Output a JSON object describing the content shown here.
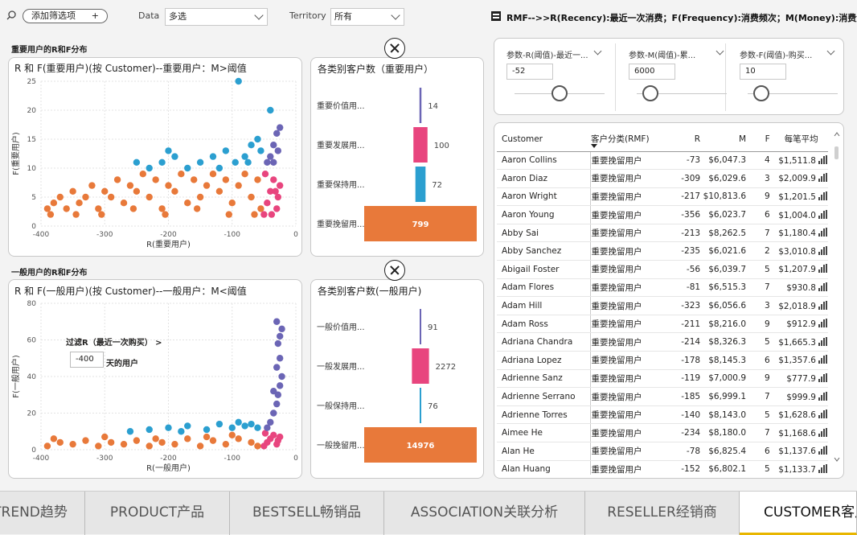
{
  "toolbar": {
    "add_filter": "添加筛选项",
    "add_filter_plus": "+",
    "data_label": "Data",
    "data_value": "多选",
    "territory_label": "Territory",
    "territory_value": "所有",
    "rmf_note": "RMF-->>R(Recency):最近一次消费；F(Frequency):消费频次；M(Money):消费金额"
  },
  "important": {
    "section_title": "重要用户的R和F分布",
    "scatter_title": "R 和 F(重要用户)(按 Customer)--重要用户：M>阈值",
    "bar_title": "各类别客户数（重要用户）"
  },
  "general": {
    "section_title": "一般用户的R和F分布",
    "scatter_title": "R 和 F(一般用户)(按 Customer)--一般用户：M<阈值",
    "bar_title": "各类别客户数(一般用户)",
    "filter_label": "过滤R（最近一次购买） >",
    "filter_value": "-400",
    "filter_suffix": "天的用户"
  },
  "params": [
    {
      "title": "参数-R(阈值)-最近一...",
      "value": "-52",
      "level": 0.5
    },
    {
      "title": "参数-M(阈值)-累...",
      "value": "6000",
      "level": 0.15
    },
    {
      "title": "参数-F(阈值)-购买...",
      "value": "10",
      "level": 0.15
    }
  ],
  "table": {
    "columns": [
      "Customer",
      "客户分类(RMF)",
      "R",
      "M",
      "F",
      "每笔平均"
    ],
    "rows": [
      [
        "Aaron Collins",
        "重要挽留用户",
        "-73",
        "$6,047.3",
        "4",
        "$1,511.8"
      ],
      [
        "Aaron Diaz",
        "重要挽留用户",
        "-309",
        "$6,029.6",
        "3",
        "$2,009.9"
      ],
      [
        "Aaron Wright",
        "重要挽留用户",
        "-217",
        "$10,813.6",
        "9",
        "$1,201.5"
      ],
      [
        "Aaron Young",
        "重要挽留用户",
        "-356",
        "$6,023.7",
        "6",
        "$1,004.0"
      ],
      [
        "Abby Sai",
        "重要挽留用户",
        "-213",
        "$8,262.5",
        "7",
        "$1,180.4"
      ],
      [
        "Abby Sanchez",
        "重要挽留用户",
        "-235",
        "$6,021.6",
        "2",
        "$3,010.8"
      ],
      [
        "Abigail Foster",
        "重要挽留用户",
        "-56",
        "$6,039.7",
        "5",
        "$1,207.9"
      ],
      [
        "Adam Flores",
        "重要挽留用户",
        "-81",
        "$6,515.3",
        "7",
        "$930.8"
      ],
      [
        "Adam Hill",
        "重要挽留用户",
        "-323",
        "$6,056.6",
        "3",
        "$2,018.9"
      ],
      [
        "Adam Ross",
        "重要挽留用户",
        "-211",
        "$8,216.0",
        "9",
        "$912.9"
      ],
      [
        "Adriana Chandra",
        "重要挽留用户",
        "-214",
        "$8,326.3",
        "5",
        "$1,665.3"
      ],
      [
        "Adriana Lopez",
        "重要挽留用户",
        "-178",
        "$8,145.3",
        "6",
        "$1,357.6"
      ],
      [
        "Adrienne Sanz",
        "重要挽留用户",
        "-119",
        "$7,000.9",
        "9",
        "$777.9"
      ],
      [
        "Adrienne Serrano",
        "重要挽留用户",
        "-185",
        "$6,999.1",
        "7",
        "$999.9"
      ],
      [
        "Adrienne Torres",
        "重要挽留用户",
        "-140",
        "$8,143.0",
        "5",
        "$1,628.6"
      ],
      [
        "Aimee He",
        "重要挽留用户",
        "-234",
        "$8,180.0",
        "7",
        "$1,168.6"
      ],
      [
        "Alan He",
        "重要挽留用户",
        "-78",
        "$6,825.4",
        "6",
        "$1,137.6"
      ],
      [
        "Alan Huang",
        "重要挽留用户",
        "-152",
        "$6,802.1",
        "5",
        "$1,133.7"
      ]
    ]
  },
  "tabs": [
    "TREND趋势",
    "PRODUCT产品",
    "BESTSELL畅销品",
    "ASSOCIATION关联分析",
    "RESELLER经销商",
    "CUSTOMER客户"
  ],
  "colors": {
    "orange": "#e8793a",
    "blue": "#2b9fd0",
    "pink": "#e8457e",
    "purple": "#6b65b5"
  },
  "chart_data": [
    {
      "type": "scatter",
      "title": "R 和 F(重要用户)(按 Customer)--重要用户：M>阈值",
      "xlabel": "R(重要用户)",
      "ylabel": "F(重要用户)",
      "xlim": [
        -400,
        0
      ],
      "ylim": [
        0,
        25
      ],
      "xticks": [
        "-400",
        "-300",
        "-200",
        "-100",
        "0"
      ],
      "yticks": [
        "0",
        "5",
        "10",
        "15",
        "20",
        "25"
      ],
      "series": [
        {
          "color": "#e8793a",
          "points": [
            [
              -390,
              3
            ],
            [
              -380,
              4
            ],
            [
              -370,
              5
            ],
            [
              -360,
              3
            ],
            [
              -350,
              6
            ],
            [
              -340,
              4
            ],
            [
              -330,
              5
            ],
            [
              -320,
              7
            ],
            [
              -310,
              3
            ],
            [
              -300,
              6
            ],
            [
              -290,
              5
            ],
            [
              -280,
              8
            ],
            [
              -270,
              4
            ],
            [
              -260,
              7
            ],
            [
              -250,
              6
            ],
            [
              -240,
              9
            ],
            [
              -230,
              5
            ],
            [
              -220,
              8
            ],
            [
              -210,
              3
            ],
            [
              -200,
              7
            ],
            [
              -190,
              6
            ],
            [
              -180,
              9
            ],
            [
              -170,
              4
            ],
            [
              -160,
              8
            ],
            [
              -150,
              5
            ],
            [
              -140,
              7
            ],
            [
              -130,
              9
            ],
            [
              -120,
              6
            ],
            [
              -110,
              8
            ],
            [
              -100,
              4
            ],
            [
              -90,
              7
            ],
            [
              -80,
              9
            ],
            [
              -70,
              5
            ],
            [
              -60,
              8
            ],
            [
              -55,
              3
            ],
            [
              -385,
              2
            ],
            [
              -345,
              2
            ],
            [
              -305,
              2
            ],
            [
              -255,
              3
            ],
            [
              -205,
              2
            ],
            [
              -155,
              3
            ],
            [
              -105,
              2
            ],
            [
              -65,
              2
            ]
          ]
        },
        {
          "color": "#2b9fd0",
          "points": [
            [
              -250,
              11
            ],
            [
              -230,
              10
            ],
            [
              -210,
              11
            ],
            [
              -190,
              12
            ],
            [
              -170,
              10
            ],
            [
              -150,
              11
            ],
            [
              -130,
              12
            ],
            [
              -110,
              13
            ],
            [
              -95,
              11
            ],
            [
              -90,
              25
            ],
            [
              -80,
              12
            ],
            [
              -70,
              14
            ],
            [
              -60,
              15
            ],
            [
              -55,
              13
            ],
            [
              -40,
              20
            ],
            [
              -200,
              13
            ],
            [
              -120,
              10
            ],
            [
              -75,
              11
            ]
          ]
        },
        {
          "color": "#e8457e",
          "points": [
            [
              -50,
              2
            ],
            [
              -45,
              4
            ],
            [
              -40,
              6
            ],
            [
              -35,
              8
            ],
            [
              -30,
              3
            ],
            [
              -28,
              5
            ],
            [
              -25,
              7
            ],
            [
              -48,
              9
            ],
            [
              -38,
              2
            ],
            [
              -32,
              6
            ]
          ]
        },
        {
          "color": "#6b65b5",
          "points": [
            [
              -45,
              11
            ],
            [
              -40,
              12
            ],
            [
              -35,
              14
            ],
            [
              -30,
              16
            ],
            [
              -28,
              13
            ],
            [
              -25,
              17
            ],
            [
              -35,
              11
            ]
          ]
        }
      ]
    },
    {
      "type": "bar",
      "title": "各类别客户数（重要用户）",
      "categories": [
        "重要价值用...",
        "重要发展用...",
        "重要保持用...",
        "重要挽留用..."
      ],
      "values": [
        14,
        100,
        72,
        799
      ],
      "colors": [
        "#6b65b5",
        "#e8457e",
        "#2b9fd0",
        "#e8793a"
      ]
    },
    {
      "type": "scatter",
      "title": "R 和 F(一般用户)(按 Customer)--一般用户：M<阈值",
      "xlabel": "R(一般用户)",
      "ylabel": "F(一般用户)",
      "xlim": [
        -400,
        0
      ],
      "ylim": [
        0,
        80
      ],
      "xticks": [
        "-400",
        "-300",
        "-200",
        "-100",
        "0"
      ],
      "yticks": [
        "0",
        "20",
        "40",
        "60",
        "80"
      ],
      "series": [
        {
          "color": "#e8793a",
          "points": [
            [
              -390,
              2
            ],
            [
              -370,
              4
            ],
            [
              -350,
              3
            ],
            [
              -330,
              5
            ],
            [
              -310,
              2
            ],
            [
              -290,
              4
            ],
            [
              -270,
              3
            ],
            [
              -250,
              5
            ],
            [
              -230,
              2
            ],
            [
              -210,
              4
            ],
            [
              -190,
              3
            ],
            [
              -170,
              6
            ],
            [
              -150,
              2
            ],
            [
              -130,
              5
            ],
            [
              -110,
              3
            ],
            [
              -90,
              6
            ],
            [
              -70,
              4
            ],
            [
              -60,
              2
            ],
            [
              -380,
              6
            ],
            [
              -300,
              7
            ],
            [
              -220,
              6
            ],
            [
              -140,
              7
            ],
            [
              -100,
              8
            ]
          ]
        },
        {
          "color": "#2b9fd0",
          "points": [
            [
              -260,
              10
            ],
            [
              -230,
              11
            ],
            [
              -200,
              12
            ],
            [
              -170,
              13
            ],
            [
              -140,
              11
            ],
            [
              -120,
              14
            ],
            [
              -100,
              12
            ],
            [
              -90,
              15
            ],
            [
              -80,
              13
            ],
            [
              -70,
              14
            ],
            [
              -60,
              12
            ],
            [
              -180,
              10
            ]
          ]
        },
        {
          "color": "#e8457e",
          "points": [
            [
              -50,
              2
            ],
            [
              -45,
              4
            ],
            [
              -40,
              6
            ],
            [
              -35,
              8
            ],
            [
              -30,
              3
            ],
            [
              -28,
              5
            ],
            [
              -25,
              7
            ],
            [
              -48,
              9
            ]
          ]
        },
        {
          "color": "#6b65b5",
          "points": [
            [
              -45,
              12
            ],
            [
              -40,
              15
            ],
            [
              -35,
              20
            ],
            [
              -30,
              25
            ],
            [
              -28,
              30
            ],
            [
              -25,
              35
            ],
            [
              -30,
              45
            ],
            [
              -25,
              50
            ],
            [
              -28,
              58
            ],
            [
              -25,
              62
            ],
            [
              -22,
              66
            ],
            [
              -30,
              70
            ],
            [
              -22,
              40
            ],
            [
              -35,
              32
            ]
          ]
        }
      ]
    },
    {
      "type": "bar",
      "title": "各类别客户数(一般用户)",
      "categories": [
        "一般价值用...",
        "一般发展用...",
        "一般保持用...",
        "一般挽留用..."
      ],
      "values": [
        91,
        2272,
        76,
        14976
      ],
      "colors": [
        "#6b65b5",
        "#e8457e",
        "#2b9fd0",
        "#e8793a"
      ]
    }
  ]
}
